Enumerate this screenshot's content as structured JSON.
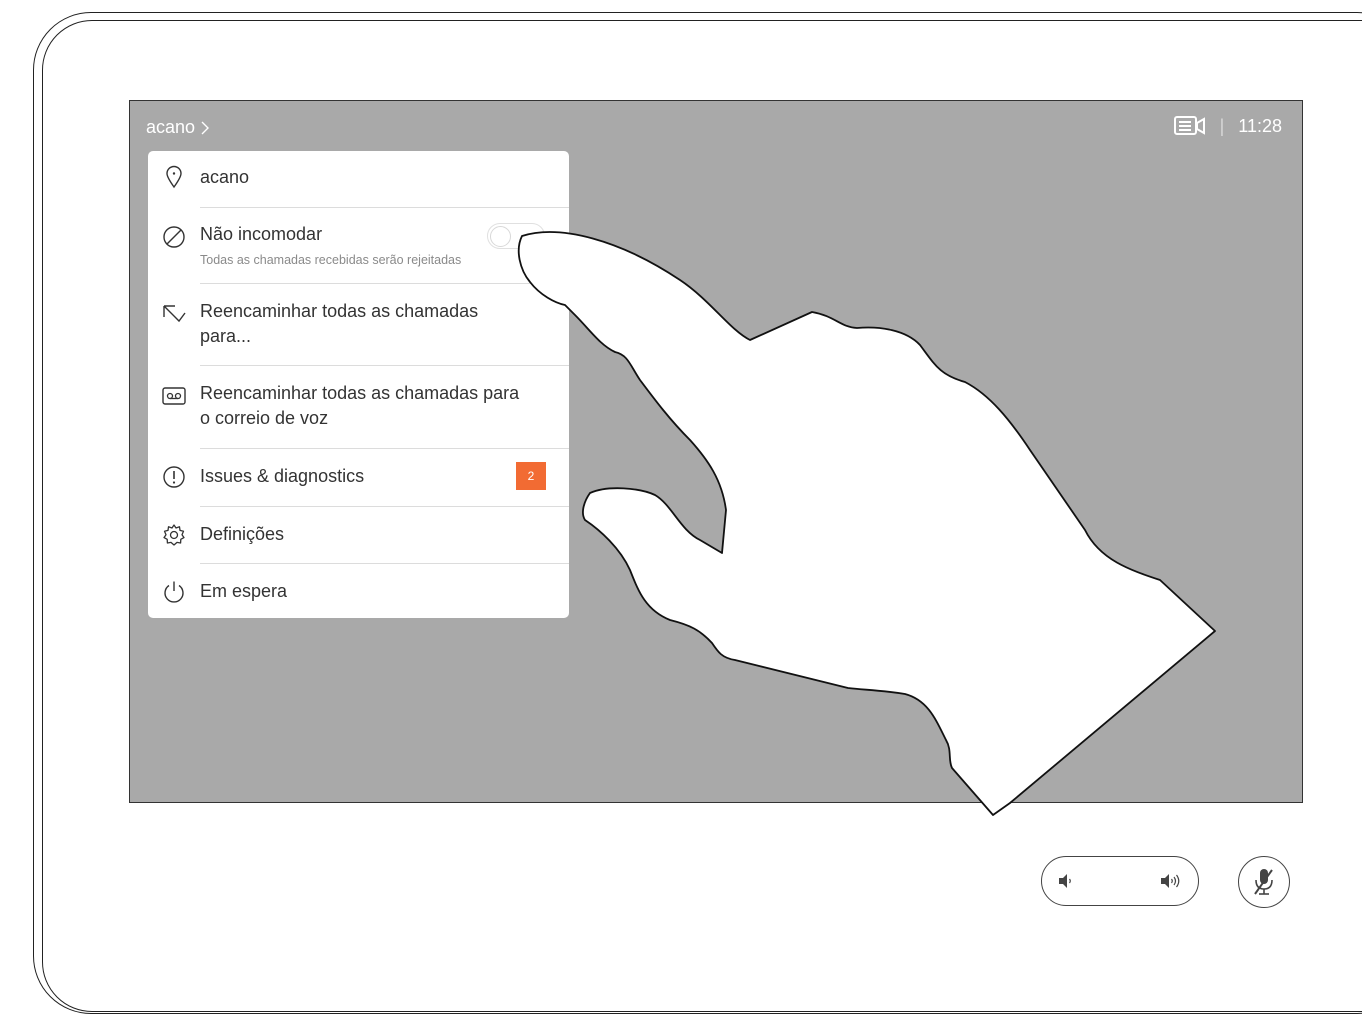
{
  "header": {
    "device_name": "acano",
    "chevron": ">",
    "camera_icon": "camera-list-icon",
    "separator": "|",
    "time": "11:28"
  },
  "menu": {
    "items": [
      {
        "icon": "location-pin-icon",
        "label": "acano"
      },
      {
        "icon": "do-not-disturb-icon",
        "label": "Não incomodar",
        "sublabel": "Todas as chamadas recebidas serão rejeitadas",
        "toggle": false
      },
      {
        "icon": "forward-arrow-icon",
        "label_line1": "Reencaminhar todas as chamadas",
        "label_line2": "para..."
      },
      {
        "icon": "voicemail-icon",
        "label_line1": "Reencaminhar todas as chamadas para",
        "label_line2": "o correio de voz"
      },
      {
        "icon": "alert-circle-icon",
        "label": "Issues & diagnostics",
        "badge": "2"
      },
      {
        "icon": "gear-icon",
        "label": "Definições"
      },
      {
        "icon": "power-icon",
        "label": "Em espera"
      }
    ]
  },
  "controls": {
    "volume_down_icon": "volume-down-icon",
    "volume_up_icon": "volume-up-icon",
    "mute_icon": "microphone-muted-icon"
  },
  "colors": {
    "screen_bg": "#a9a9a9",
    "badge_bg": "#f26b33"
  }
}
